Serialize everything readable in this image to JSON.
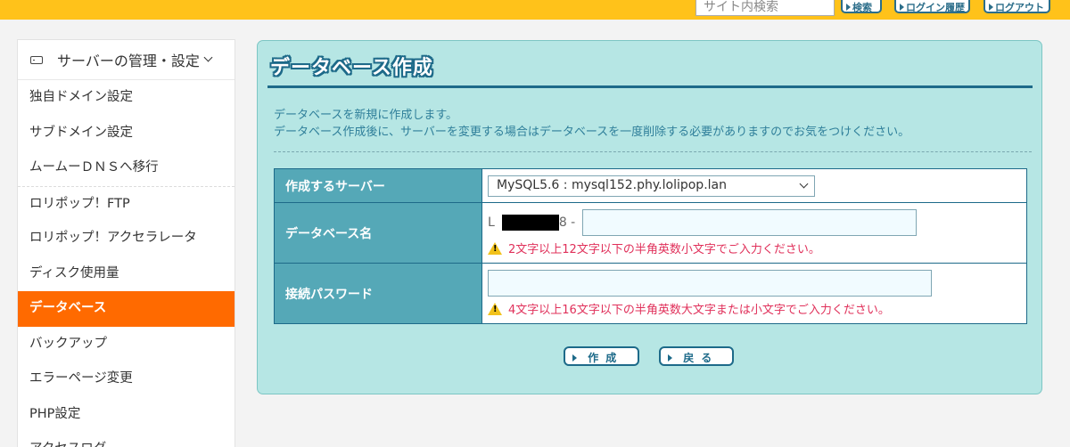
{
  "header": {
    "search_placeholder": "サイト内検索",
    "search_button": "検索",
    "login_history_button": "ログイン履歴",
    "logout_button": "ログアウト"
  },
  "sidebar": {
    "section_title": "サーバーの管理・設定",
    "section_icon": "drive-icon",
    "items": [
      {
        "label": "独自ドメイン設定"
      },
      {
        "label": "サブドメイン設定"
      },
      {
        "label": "ムームーＤＮＳへ移行"
      },
      {
        "label": "ロリポップ！FTP"
      },
      {
        "label": "ロリポップ！アクセラレータ"
      },
      {
        "label": "ディスク使用量"
      },
      {
        "label": "データベース",
        "active": true
      },
      {
        "label": "バックアップ"
      },
      {
        "label": "エラーページ変更"
      },
      {
        "label": "PHP設定"
      },
      {
        "label": "アクセスログ"
      }
    ]
  },
  "main": {
    "title": "データベース作成",
    "description": [
      "データベースを新規に作成します。",
      "データベース作成後に、サーバーを変更する場合はデータベースを一度削除する必要がありますのでお気をつけください。"
    ],
    "form": {
      "server_label": "作成するサーバー",
      "server_value": "MySQL5.6 : mysql152.phy.lolipop.lan",
      "dbname_label": "データベース名",
      "dbname_prefix": "L",
      "dbname_prefix_tail": "8 -",
      "dbname_value": "",
      "dbname_warning": "2文字以上12文字以下の半角英数小文字でご入力ください。",
      "password_label": "接続パスワード",
      "password_value": "",
      "password_warning": "4文字以上16文字以下の半角英数大文字または小文字でご入力ください。"
    },
    "buttons": {
      "create": "作成",
      "back": "戻る"
    }
  },
  "colors": {
    "topbar": "#ffc21a",
    "active_menu": "#ff6a00",
    "panel_bg": "#b6e6e4",
    "label_cell": "#55a8b7",
    "accent": "#1d6a89",
    "warning_text": "#e0305a"
  }
}
